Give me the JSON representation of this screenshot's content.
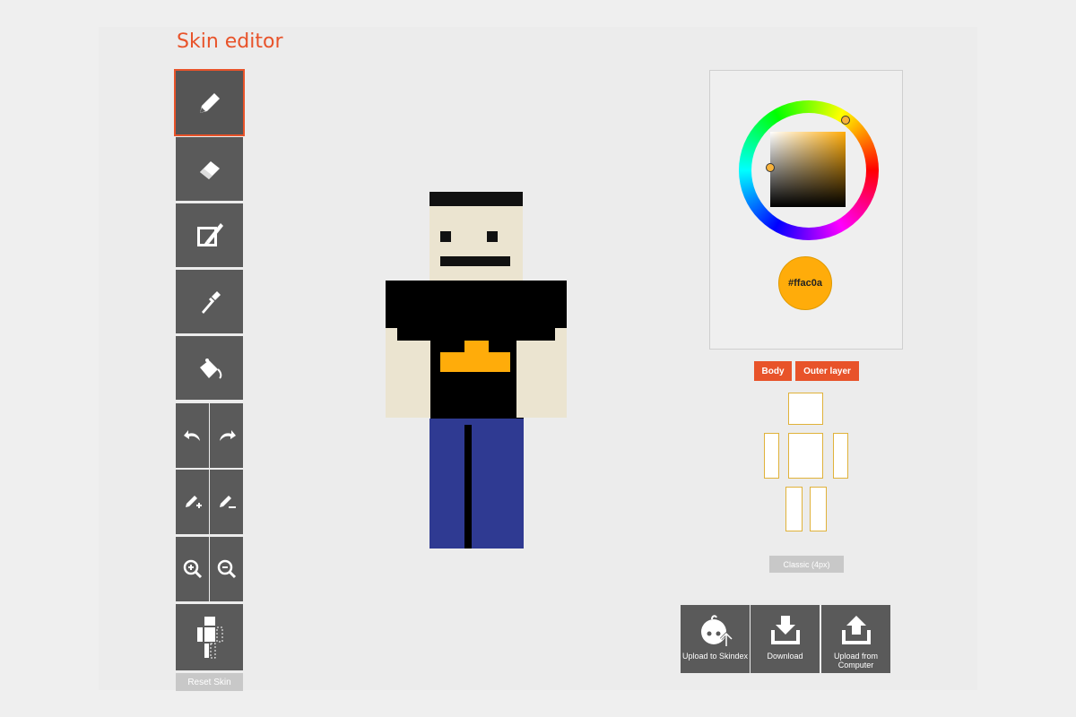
{
  "header": {
    "title": "Skin editor"
  },
  "toolbar": {
    "tools": [
      "pencil",
      "eraser",
      "brush",
      "eyedropper",
      "bucket-fill"
    ],
    "undo_icon": "undo-icon",
    "redo_icon": "redo-icon",
    "reset_label": "Reset Skin"
  },
  "color_picker": {
    "current_color": "#ffac0a",
    "hex_label": "#ffac0a"
  },
  "layers": {
    "body_label": "Body",
    "outer_label": "Outer layer"
  },
  "model": {
    "selected": "Classic (4px)"
  },
  "actions": {
    "upload_skindex": "Upload to Skindex",
    "download": "Download",
    "upload_computer": "Upload from Computer"
  },
  "colors": {
    "accent": "#e8532a",
    "tool_bg": "#5a5a5a",
    "skin": "#ebe4d0",
    "shirt": "#000000",
    "pants": "#2f3a92",
    "logo": "#ffac0a"
  }
}
